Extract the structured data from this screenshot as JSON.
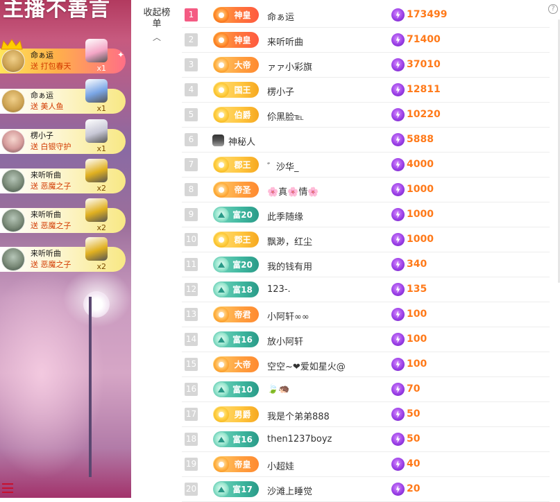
{
  "streamer_title": "主播不善言",
  "collapse": {
    "label": "收起榜单"
  },
  "help_glyph": "?",
  "gift_feed": [
    {
      "user": "命ぁ运",
      "action": "送 打包春天",
      "count": "x1",
      "avatar": "cat",
      "highlight": true,
      "gift_color": "#f4a6c6"
    },
    {
      "user": "命ぁ运",
      "action": "送 美人鱼",
      "count": "x1",
      "avatar": "cat",
      "highlight": false,
      "gift_color": "#7aa6e6"
    },
    {
      "user": "楞小子",
      "action": "送 白银守护",
      "count": "x1",
      "avatar": "girl",
      "highlight": false,
      "gift_color": "#c8c8d6"
    },
    {
      "user": "来听听曲",
      "action": "送 恶魔之子",
      "count": "x2",
      "avatar": "man",
      "highlight": false,
      "gift_color": "#e0b020"
    },
    {
      "user": "来听听曲",
      "action": "送 恶魔之子",
      "count": "x2",
      "avatar": "man",
      "highlight": false,
      "gift_color": "#e0b020"
    },
    {
      "user": "来听听曲",
      "action": "送 恶魔之子",
      "count": "x2",
      "avatar": "man",
      "highlight": false,
      "gift_color": "#e0b020"
    }
  ],
  "ranking": [
    {
      "rank": "1",
      "badge": "神皇",
      "badge_style": "red",
      "name": "命ぁ运",
      "points": "173499"
    },
    {
      "rank": "2",
      "badge": "神皇",
      "badge_style": "red",
      "name": "来听听曲",
      "points": "71400"
    },
    {
      "rank": "3",
      "badge": "大帝",
      "badge_style": "orange",
      "name": "ァァ小彩旗",
      "points": "37010"
    },
    {
      "rank": "4",
      "badge": "国王",
      "badge_style": "gold",
      "name": "楞小子",
      "points": "12811"
    },
    {
      "rank": "5",
      "badge": "伯爵",
      "badge_style": "gold",
      "name": "伱黑脸℡",
      "points": "10220"
    },
    {
      "rank": "6",
      "badge": "",
      "badge_style": "mystery",
      "name": "神秘人",
      "points": "5888"
    },
    {
      "rank": "7",
      "badge": "郡王",
      "badge_style": "gold",
      "name": "゛沙华_",
      "points": "4000"
    },
    {
      "rank": "8",
      "badge": "帝圣",
      "badge_style": "orange",
      "name": "🌸真🌸情🌸",
      "points": "1000"
    },
    {
      "rank": "9",
      "badge": "富20",
      "badge_style": "teal",
      "name": "此季随缘",
      "points": "1000"
    },
    {
      "rank": "10",
      "badge": "郡王",
      "badge_style": "gold",
      "name": "飘渺，红尘",
      "points": "1000"
    },
    {
      "rank": "11",
      "badge": "富20",
      "badge_style": "teal",
      "name": "我的钱有用",
      "points": "340"
    },
    {
      "rank": "12",
      "badge": "富18",
      "badge_style": "teal",
      "name": "123-.",
      "points": "135"
    },
    {
      "rank": "13",
      "badge": "帝君",
      "badge_style": "orange",
      "name": "小阿轩∞∞",
      "points": "100"
    },
    {
      "rank": "14",
      "badge": "富16",
      "badge_style": "teal",
      "name": "放小阿轩",
      "points": "100"
    },
    {
      "rank": "15",
      "badge": "大帝",
      "badge_style": "orange",
      "name": "空空~❤爱如星火@",
      "points": "100"
    },
    {
      "rank": "16",
      "badge": "富10",
      "badge_style": "teal",
      "name": "🍃🦔",
      "points": "70"
    },
    {
      "rank": "17",
      "badge": "男爵",
      "badge_style": "gold",
      "name": "我是个弟弟888",
      "points": "50"
    },
    {
      "rank": "18",
      "badge": "富16",
      "badge_style": "teal",
      "name": "then1237boyz",
      "points": "50"
    },
    {
      "rank": "19",
      "badge": "帝皇",
      "badge_style": "orange",
      "name": "小超娃",
      "points": "40"
    },
    {
      "rank": "20",
      "badge": "富17",
      "badge_style": "teal",
      "name": "沙滩上睡觉",
      "points": "20"
    }
  ],
  "colors": {
    "accent_points": "#ff7a1a",
    "top_rank": "#f45b83",
    "coin": "#9a3ee6"
  }
}
